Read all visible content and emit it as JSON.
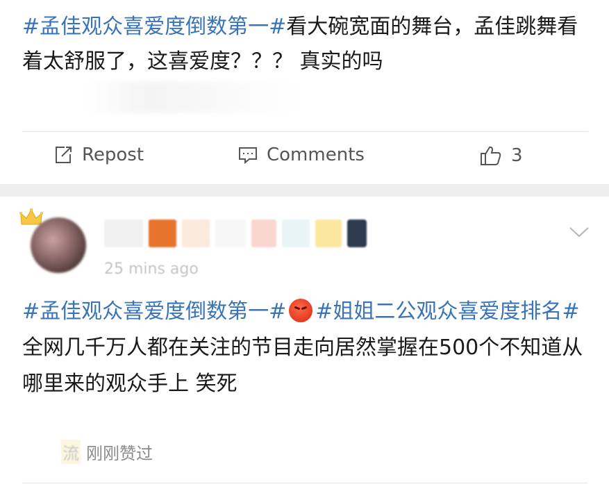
{
  "post": {
    "hashtag": "#孟佳观众喜爱度倒数第一#",
    "text": "看大碗宽面的舞台，孟佳跳舞看着太舒服了，这喜爱度？？？ 真实的吗"
  },
  "actions": {
    "repost_label": "Repost",
    "comments_label": "Comments",
    "like_count": "3"
  },
  "comment": {
    "time": "25 mins ago",
    "hashtag1": "#孟佳观众喜爱度倒数第一#",
    "hashtag2": "#姐姐二公观众喜爱度排名#",
    "body": "全网几千万人都在关注的节目走向居然掌握在500个不知道从哪里来的观众手上 笑死",
    "liked_by_name": "流",
    "liked_by_suffix": "刚刚赞过"
  },
  "icons": {
    "repost": "repost-icon",
    "comments": "comment-icon",
    "like": "thumbs-up-icon",
    "crown": "crown-icon",
    "chevron": "chevron-down-icon",
    "emoji": "angry-face-emoji"
  },
  "colors": {
    "hashtag": "#3a74b8",
    "divider": "#e6e6e6",
    "gap": "#eeeeee",
    "muted": "#555555"
  }
}
